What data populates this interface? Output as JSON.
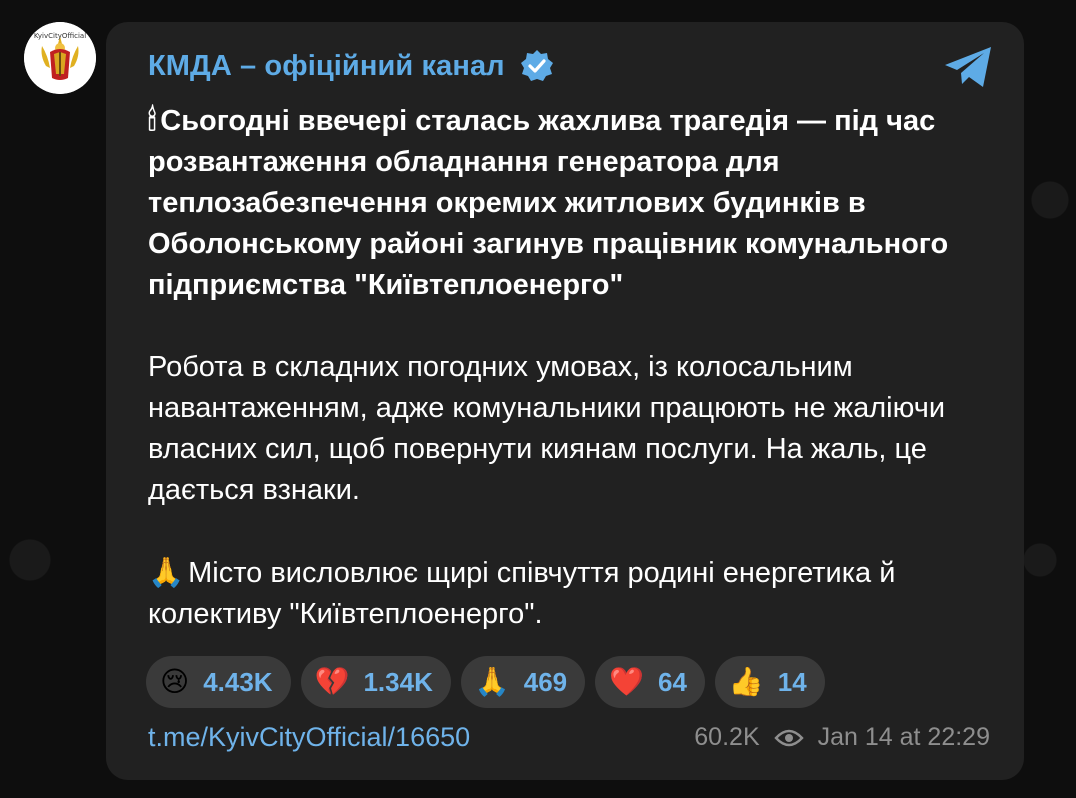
{
  "channel": {
    "name": "КМДА – офіційний канал",
    "avatar_caption": "KyivCityOfficial"
  },
  "post": {
    "p1_emoji": "🕯",
    "p1_text": "Сьогодні ввечері сталась жахлива трагедія — під час розвантаження обладнання генератора для теплозабезпечення окремих житлових будинків в Оболонському районі загинув працівник комунального підприємства \"Київтеплоенерго\"",
    "p2_text": "Робота в складних погодних умовах, із колосальним навантаженням, адже комунальники працюють не жаліючи власних сил, щоб повернути киянам послуги. На жаль, це дається взнаки.",
    "p3_emoji": "🙏",
    "p3_text": "Місто висловлює щирі співчуття родині енергетика й колективу \"Київтеплоенерго\"."
  },
  "reactions": [
    {
      "emoji": "😢",
      "count": "4.43K"
    },
    {
      "emoji": "💔",
      "count": "1.34K"
    },
    {
      "emoji": "🙏",
      "count": "469"
    },
    {
      "emoji": "❤️",
      "count": "64"
    },
    {
      "emoji": "👍",
      "count": "14"
    }
  ],
  "footer": {
    "link": "t.me/KyivCityOfficial/16650",
    "views": "60.2K",
    "timestamp": "Jan 14 at 22:29"
  },
  "icons": {
    "verified": "verified-badge-icon",
    "telegram": "telegram-plane-icon",
    "views": "eye-icon"
  },
  "colors": {
    "accent": "#5eabe6",
    "bubble": "#212121",
    "reaction_bg": "#3a3a3a",
    "muted": "#8e8e8e"
  }
}
